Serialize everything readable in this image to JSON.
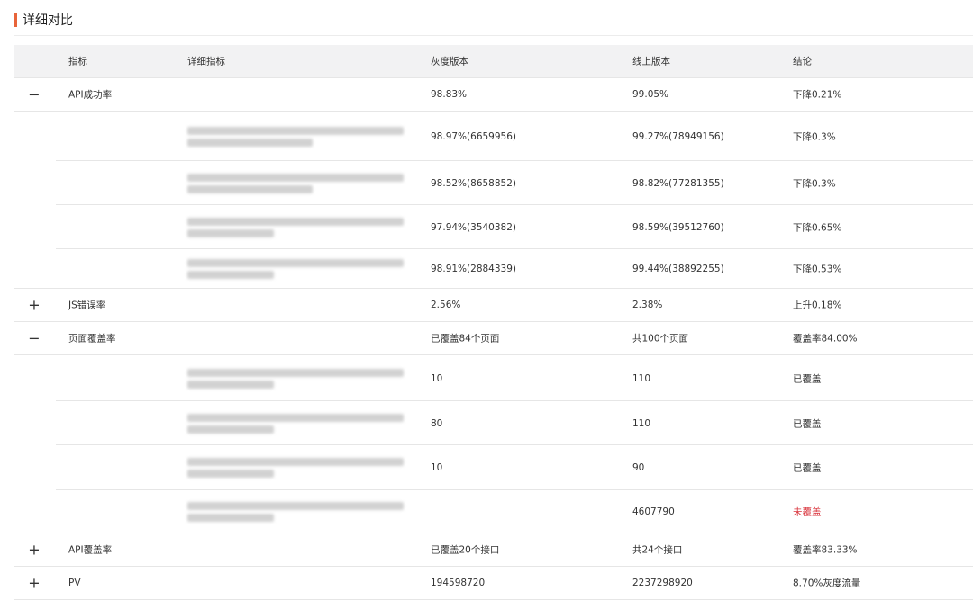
{
  "section": {
    "title": "详细对比"
  },
  "table": {
    "headers": {
      "metric": "指标",
      "detail": "详细指标",
      "gray": "灰度版本",
      "online": "线上版本",
      "conclusion": "结论"
    },
    "rows": [
      {
        "toggle": "−",
        "metric": "API成功率",
        "gray": "98.83%",
        "online": "99.05%",
        "conclusion": "下降0.21%"
      },
      {
        "gray": "98.97%(6659956)",
        "online": "99.27%(78949156)",
        "conclusion": "下降0.3%"
      },
      {
        "gray": "98.52%(8658852)",
        "online": "98.82%(77281355)",
        "conclusion": "下降0.3%"
      },
      {
        "gray": "97.94%(3540382)",
        "online": "98.59%(39512760)",
        "conclusion": "下降0.65%"
      },
      {
        "gray": "98.91%(2884339)",
        "online": "99.44%(38892255)",
        "conclusion": "下降0.53%"
      },
      {
        "toggle": "+",
        "metric": "JS错误率",
        "gray": "2.56%",
        "online": "2.38%",
        "conclusion": "上升0.18%"
      },
      {
        "toggle": "−",
        "metric": "页面覆盖率",
        "gray": "已覆盖84个页面",
        "online": "共100个页面",
        "conclusion": "覆盖率84.00%"
      },
      {
        "gray": "10",
        "online": "110",
        "conclusion": "已覆盖"
      },
      {
        "gray": "80",
        "online": "110",
        "conclusion": "已覆盖"
      },
      {
        "gray": "10",
        "online": "90",
        "conclusion": "已覆盖"
      },
      {
        "gray": "",
        "online": "4607790",
        "conclusion": "未覆盖"
      },
      {
        "toggle": "+",
        "metric": "API覆盖率",
        "gray": "已覆盖20个接口",
        "online": "共24个接口",
        "conclusion": "覆盖率83.33%"
      },
      {
        "toggle": "+",
        "metric": "PV",
        "gray": "194598720",
        "online": "2237298920",
        "conclusion": "8.70%灰度流量"
      }
    ]
  },
  "colors": {
    "accent": "#e8643a",
    "header_bg": "#f2f2f3",
    "negative": "#d9363e"
  },
  "icons": {
    "expanded": "minus-icon",
    "collapsed": "plus-icon"
  }
}
